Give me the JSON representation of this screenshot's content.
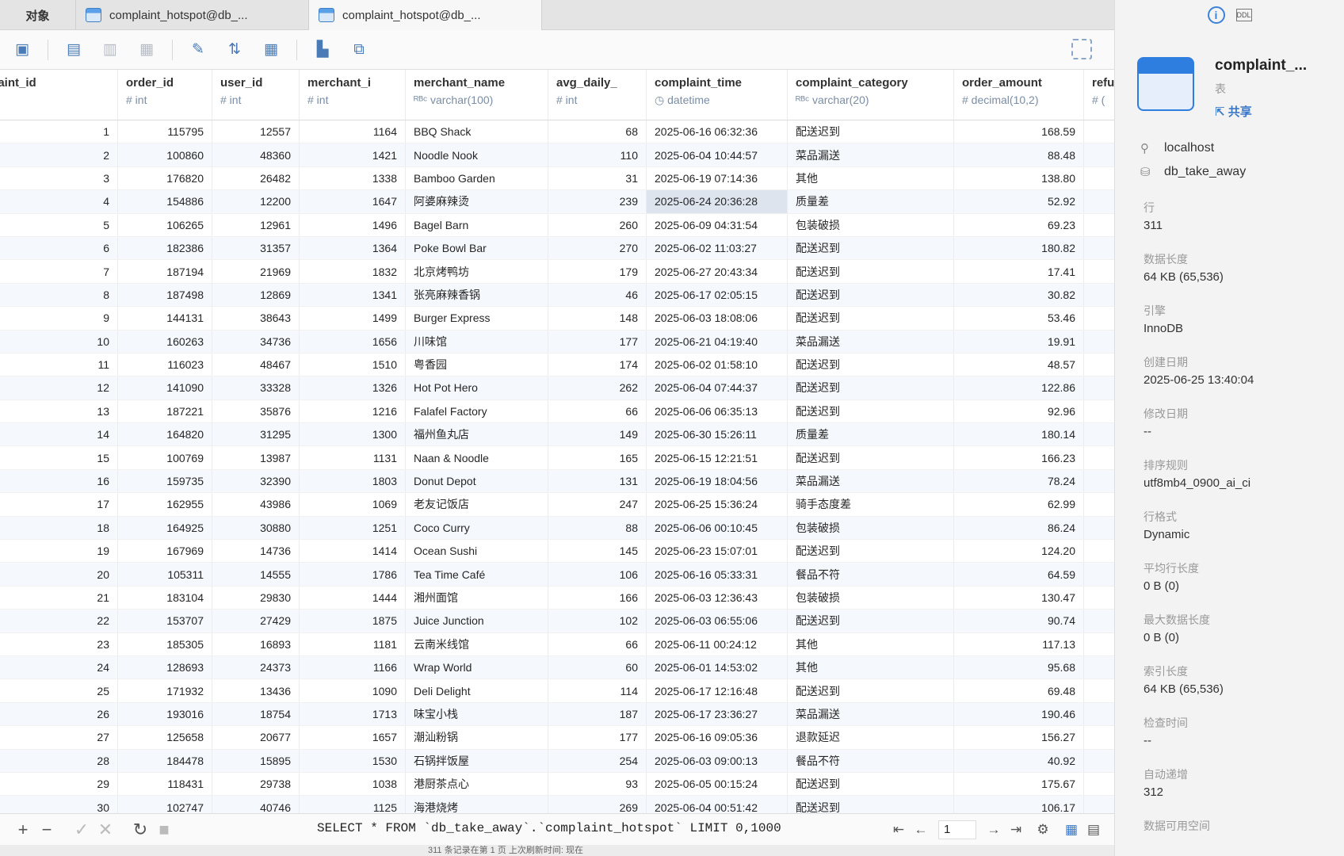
{
  "tabs": {
    "objects": "对象",
    "tab1": "complaint_hotspot@db_...",
    "tab2": "complaint_hotspot@db_..."
  },
  "columns": [
    {
      "name": "plaint_id",
      "type": "nt"
    },
    {
      "name": "order_id",
      "type": "# int"
    },
    {
      "name": "user_id",
      "type": "# int"
    },
    {
      "name": "merchant_i",
      "type": "# int"
    },
    {
      "name": "merchant_name",
      "type": "ᴿᴮᶜ varchar(100)"
    },
    {
      "name": "avg_daily_",
      "type": "# int"
    },
    {
      "name": "complaint_time",
      "type": "◷ datetime"
    },
    {
      "name": "complaint_category",
      "type": "ᴿᴮᶜ varchar(20)"
    },
    {
      "name": "order_amount",
      "type": "# decimal(10,2)"
    },
    {
      "name": "refu",
      "type": "# ("
    }
  ],
  "rows": [
    [
      "1",
      "115795",
      "12557",
      "1164",
      "BBQ Shack",
      "68",
      "2025-06-16 06:32:36",
      "配送迟到",
      "168.59"
    ],
    [
      "2",
      "100860",
      "48360",
      "1421",
      "Noodle Nook",
      "110",
      "2025-06-04 10:44:57",
      "菜品漏送",
      "88.48"
    ],
    [
      "3",
      "176820",
      "26482",
      "1338",
      "Bamboo Garden",
      "31",
      "2025-06-19 07:14:36",
      "其他",
      "138.80"
    ],
    [
      "4",
      "154886",
      "12200",
      "1647",
      "阿婆麻辣烫",
      "239",
      "2025-06-24 20:36:28",
      "质量差",
      "52.92"
    ],
    [
      "5",
      "106265",
      "12961",
      "1496",
      "Bagel Barn",
      "260",
      "2025-06-09 04:31:54",
      "包装破损",
      "69.23"
    ],
    [
      "6",
      "182386",
      "31357",
      "1364",
      "Poke Bowl Bar",
      "270",
      "2025-06-02 11:03:27",
      "配送迟到",
      "180.82"
    ],
    [
      "7",
      "187194",
      "21969",
      "1832",
      "北京烤鸭坊",
      "179",
      "2025-06-27 20:43:34",
      "配送迟到",
      "17.41"
    ],
    [
      "8",
      "187498",
      "12869",
      "1341",
      "张亮麻辣香锅",
      "46",
      "2025-06-17 02:05:15",
      "配送迟到",
      "30.82"
    ],
    [
      "9",
      "144131",
      "38643",
      "1499",
      "Burger Express",
      "148",
      "2025-06-03 18:08:06",
      "配送迟到",
      "53.46"
    ],
    [
      "10",
      "160263",
      "34736",
      "1656",
      "川味馆",
      "177",
      "2025-06-21 04:19:40",
      "菜品漏送",
      "19.91"
    ],
    [
      "11",
      "116023",
      "48467",
      "1510",
      "粤香园",
      "174",
      "2025-06-02 01:58:10",
      "配送迟到",
      "48.57"
    ],
    [
      "12",
      "141090",
      "33328",
      "1326",
      "Hot Pot Hero",
      "262",
      "2025-06-04 07:44:37",
      "配送迟到",
      "122.86"
    ],
    [
      "13",
      "187221",
      "35876",
      "1216",
      "Falafel Factory",
      "66",
      "2025-06-06 06:35:13",
      "配送迟到",
      "92.96"
    ],
    [
      "14",
      "164820",
      "31295",
      "1300",
      "福州鱼丸店",
      "149",
      "2025-06-30 15:26:11",
      "质量差",
      "180.14"
    ],
    [
      "15",
      "100769",
      "13987",
      "1131",
      "Naan & Noodle",
      "165",
      "2025-06-15 12:21:51",
      "配送迟到",
      "166.23"
    ],
    [
      "16",
      "159735",
      "32390",
      "1803",
      "Donut Depot",
      "131",
      "2025-06-19 18:04:56",
      "菜品漏送",
      "78.24"
    ],
    [
      "17",
      "162955",
      "43986",
      "1069",
      "老友记饭店",
      "247",
      "2025-06-25 15:36:24",
      "骑手态度差",
      "62.99"
    ],
    [
      "18",
      "164925",
      "30880",
      "1251",
      "Coco Curry",
      "88",
      "2025-06-06 00:10:45",
      "包装破损",
      "86.24"
    ],
    [
      "19",
      "167969",
      "14736",
      "1414",
      "Ocean Sushi",
      "145",
      "2025-06-23 15:07:01",
      "配送迟到",
      "124.20"
    ],
    [
      "20",
      "105311",
      "14555",
      "1786",
      "Tea Time Café",
      "106",
      "2025-06-16 05:33:31",
      "餐品不符",
      "64.59"
    ],
    [
      "21",
      "183104",
      "29830",
      "1444",
      "湘州面馆",
      "166",
      "2025-06-03 12:36:43",
      "包装破损",
      "130.47"
    ],
    [
      "22",
      "153707",
      "27429",
      "1875",
      "Juice Junction",
      "102",
      "2025-06-03 06:55:06",
      "配送迟到",
      "90.74"
    ],
    [
      "23",
      "185305",
      "16893",
      "1181",
      "云南米线馆",
      "66",
      "2025-06-11 00:24:12",
      "其他",
      "117.13"
    ],
    [
      "24",
      "128693",
      "24373",
      "1166",
      "Wrap World",
      "60",
      "2025-06-01 14:53:02",
      "其他",
      "95.68"
    ],
    [
      "25",
      "171932",
      "13436",
      "1090",
      "Deli Delight",
      "114",
      "2025-06-17 12:16:48",
      "配送迟到",
      "69.48"
    ],
    [
      "26",
      "193016",
      "18754",
      "1713",
      "味宝小栈",
      "187",
      "2025-06-17 23:36:27",
      "菜品漏送",
      "190.46"
    ],
    [
      "27",
      "125658",
      "20677",
      "1657",
      "潮汕粉锅",
      "177",
      "2025-06-16 09:05:36",
      "退款延迟",
      "156.27"
    ],
    [
      "28",
      "184478",
      "15895",
      "1530",
      "石锅拌饭屋",
      "254",
      "2025-06-03 09:00:13",
      "餐品不符",
      "40.92"
    ],
    [
      "29",
      "118431",
      "29738",
      "1038",
      "港厨茶点心",
      "93",
      "2025-06-05 00:15:24",
      "配送迟到",
      "175.67"
    ],
    [
      "30",
      "102747",
      "40746",
      "1125",
      "海港烧烤",
      "269",
      "2025-06-04 00:51:42",
      "配送迟到",
      "106.17"
    ]
  ],
  "selected_cell": {
    "row": 3,
    "col": 6
  },
  "sql": "SELECT * FROM `db_take_away`.`complaint_hotspot` LIMIT 0,1000",
  "pager": {
    "page": "1"
  },
  "status": "311 条记录在第 1 页  上次刷新时间: 现在",
  "panel": {
    "name": "complaint_...",
    "kind": "表",
    "share": "共享",
    "host": "localhost",
    "database": "db_take_away",
    "props": [
      {
        "label": "行",
        "value": "311"
      },
      {
        "label": "数据长度",
        "value": "64 KB (65,536)"
      },
      {
        "label": "引擎",
        "value": "InnoDB"
      },
      {
        "label": "创建日期",
        "value": "2025-06-25 13:40:04"
      },
      {
        "label": "修改日期",
        "value": "--"
      },
      {
        "label": "排序规则",
        "value": "utf8mb4_0900_ai_ci"
      },
      {
        "label": "行格式",
        "value": "Dynamic"
      },
      {
        "label": "平均行长度",
        "value": "0 B (0)"
      },
      {
        "label": "最大数据长度",
        "value": "0 B (0)"
      },
      {
        "label": "索引长度",
        "value": "64 KB (65,536)"
      },
      {
        "label": "检查时间",
        "value": "--"
      },
      {
        "label": "自动递增",
        "value": "312"
      },
      {
        "label": "数据可用空间",
        "value": ""
      }
    ]
  }
}
